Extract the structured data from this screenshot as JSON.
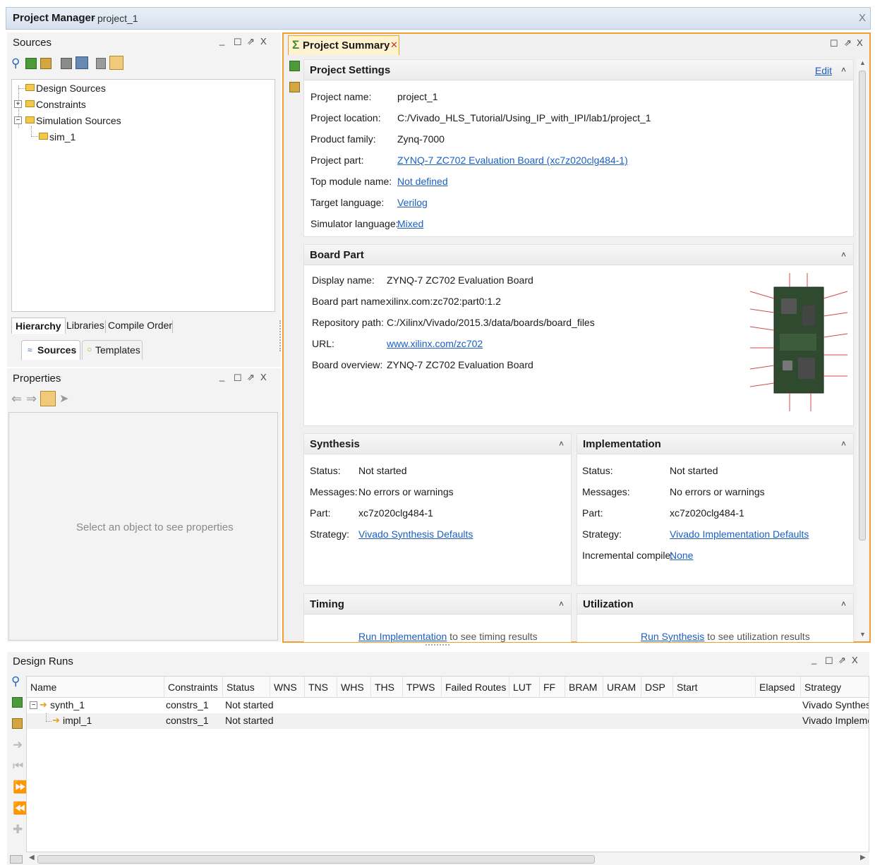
{
  "window": {
    "title": "Project Manager",
    "subtitle": "project_1",
    "close_glyph": "X"
  },
  "sources": {
    "title": "Sources",
    "tree": [
      {
        "label": "Design Sources"
      },
      {
        "label": "Constraints"
      },
      {
        "label": "Simulation Sources"
      },
      {
        "label": "sim_1"
      }
    ],
    "tabs": [
      "Hierarchy",
      "Libraries",
      "Compile Order"
    ],
    "subtabs": [
      "Sources",
      "Templates"
    ]
  },
  "properties": {
    "title": "Properties",
    "empty_text": "Select an object to see properties"
  },
  "summary": {
    "tab_label": "Project Summary",
    "project_settings": {
      "title": "Project Settings",
      "edit_label": "Edit",
      "rows": [
        {
          "label": "Project name:",
          "value": "project_1"
        },
        {
          "label": "Project location:",
          "value": "C:/Vivado_HLS_Tutorial/Using_IP_with_IPI/lab1/project_1"
        },
        {
          "label": "Product family:",
          "value": "Zynq-7000"
        },
        {
          "label": "Project part:",
          "value": "ZYNQ-7 ZC702 Evaluation Board (xc7z020clg484-1)"
        },
        {
          "label": "Top module name:",
          "value": "Not defined"
        },
        {
          "label": "Target language:",
          "value": "Verilog"
        },
        {
          "label": "Simulator language:",
          "value": "Mixed"
        }
      ]
    },
    "board_part": {
      "title": "Board Part",
      "rows": [
        {
          "label": "Display name:",
          "value": "ZYNQ-7 ZC702 Evaluation Board"
        },
        {
          "label": "Board part name:",
          "value": "xilinx.com:zc702:part0:1.2"
        },
        {
          "label": "Repository path:",
          "value": "C:/Xilinx/Vivado/2015.3/data/boards/board_files"
        },
        {
          "label": "URL:",
          "value": "www.xilinx.com/zc702"
        },
        {
          "label": "Board overview:",
          "value": "ZYNQ-7 ZC702 Evaluation Board"
        }
      ]
    },
    "synthesis": {
      "title": "Synthesis",
      "rows": [
        {
          "label": "Status:",
          "value": "Not started"
        },
        {
          "label": "Messages:",
          "value": "No errors or warnings"
        },
        {
          "label": "Part:",
          "value": "xc7z020clg484-1"
        },
        {
          "label": "Strategy:",
          "value": "Vivado Synthesis Defaults"
        }
      ]
    },
    "implementation": {
      "title": "Implementation",
      "rows": [
        {
          "label": "Status:",
          "value": "Not started"
        },
        {
          "label": "Messages:",
          "value": "No errors or warnings"
        },
        {
          "label": "Part:",
          "value": "xc7z020clg484-1"
        },
        {
          "label": "Strategy:",
          "value": "Vivado Implementation Defaults"
        },
        {
          "label": "Incremental compile:",
          "value": "None"
        }
      ]
    },
    "timing": {
      "title": "Timing",
      "link": "Run Implementation",
      "rest": " to see timing results"
    },
    "utilization": {
      "title": "Utilization",
      "link": "Run Synthesis",
      "rest": " to see utilization results"
    }
  },
  "design_runs": {
    "title": "Design Runs",
    "columns": [
      "Name",
      "Constraints",
      "Status",
      "WNS",
      "TNS",
      "WHS",
      "THS",
      "TPWS",
      "Failed Routes",
      "LUT",
      "FF",
      "BRAM",
      "URAM",
      "DSP",
      "Start",
      "Elapsed",
      "Strategy"
    ],
    "rows": [
      {
        "name": "synth_1",
        "constraints": "constrs_1",
        "status": "Not started",
        "strategy": "Vivado Synthesis"
      },
      {
        "name": "impl_1",
        "constraints": "constrs_1",
        "status": "Not started",
        "strategy": "Vivado Implemen"
      }
    ]
  },
  "colors": {
    "accent_orange": "#f0a030",
    "link_blue": "#1b5fc1",
    "title_bar": "#dfe8f3"
  }
}
